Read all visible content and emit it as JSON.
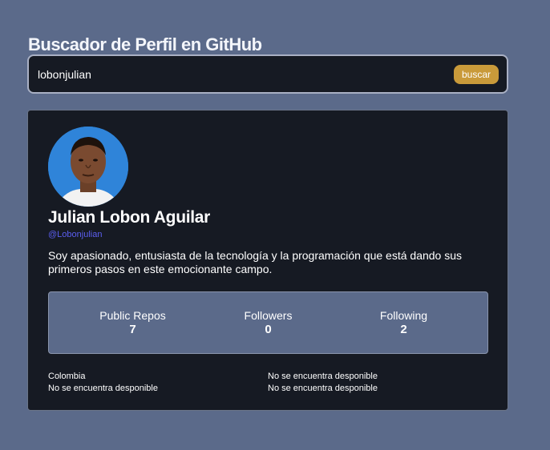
{
  "header": {
    "title": "Buscador de Perfil en GitHub"
  },
  "search": {
    "value": "lobonjulian",
    "button_label": "buscar"
  },
  "profile": {
    "name": "Julian Lobon Aguilar",
    "login": "@Lobonjulian",
    "bio": "Soy apasionado, entusiasta de la tecnología y la programación que está dando sus primeros pasos en este emocionante campo.",
    "stats": [
      {
        "label": "Public Repos",
        "value": "7"
      },
      {
        "label": "Followers",
        "value": "0"
      },
      {
        "label": "Following",
        "value": "2"
      }
    ],
    "info": {
      "location": "Colombia",
      "blog": "No se encuentra desponible",
      "twitter": "No se encuentra desponible",
      "company": "No se encuentra desponible"
    }
  },
  "colors": {
    "background": "#5b6a8a",
    "card": "#161a23",
    "accent_button": "#c99a3a",
    "login_link": "#5b5ef0"
  }
}
